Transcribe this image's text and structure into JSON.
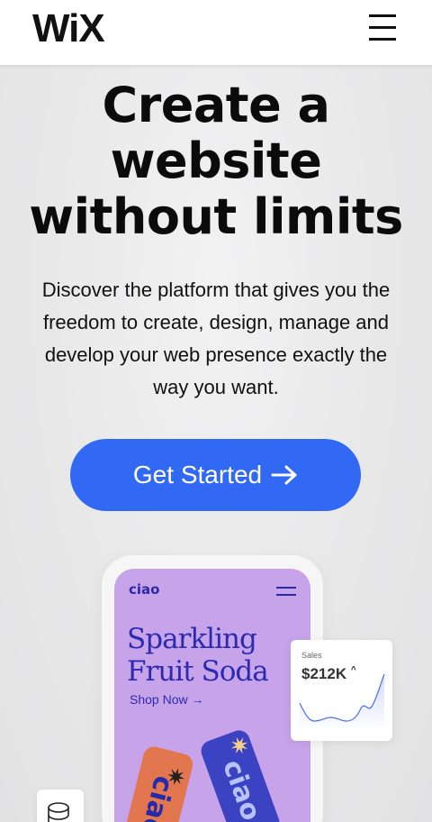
{
  "header": {
    "logo": "WiX",
    "menu_icon": "hamburger-menu-icon"
  },
  "hero": {
    "title_lines": [
      "Create a",
      "website",
      "without limits"
    ],
    "subtitle": "Discover the platform that gives you the freedom to create, design, manage and develop your web presence exactly the way you want.",
    "cta_label": "Get Started",
    "cta_icon": "arrow-right-icon"
  },
  "preview": {
    "brand": "ciao",
    "promo_lines": [
      "Sparkling",
      "Fruit Soda"
    ],
    "shop_link": "Shop Now →",
    "can_label": "ciao",
    "menu_icon": "hamburger-menu-icon"
  },
  "sales_card": {
    "label": "Sales",
    "value": "$212K",
    "trend_icon": "caret-up-icon"
  },
  "db_card": {
    "icon": "database-icon"
  },
  "colors": {
    "cta_bg": "#3169f5",
    "phone_screen": "#c7a4ea",
    "brand_text": "#2c2ab0",
    "chart_line": "#4a6ef5"
  }
}
